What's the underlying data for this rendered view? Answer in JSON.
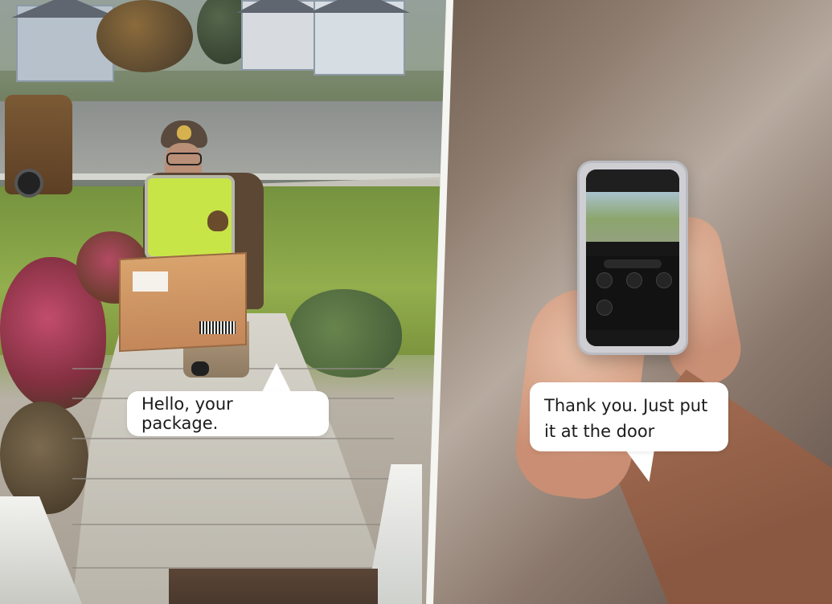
{
  "left_scene": {
    "caption": "Hello, your package."
  },
  "right_scene": {
    "caption": "Thank you. Just put it at the door"
  }
}
